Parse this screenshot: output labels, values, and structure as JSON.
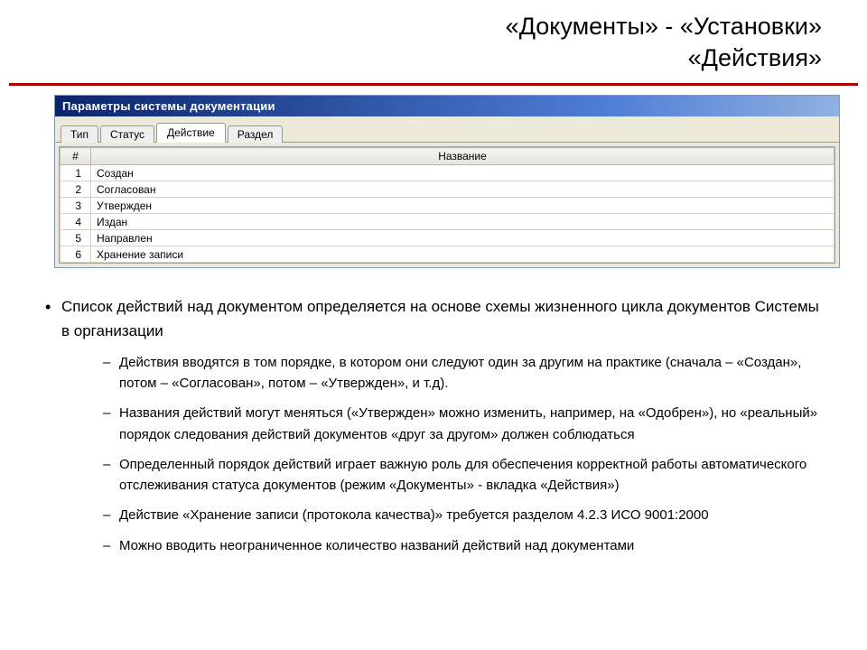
{
  "slide": {
    "title_line1": "«Документы» - «Установки»",
    "title_line2": "«Действия»"
  },
  "window": {
    "title": "Параметры системы документации",
    "tabs": [
      {
        "label": "Тип",
        "active": false
      },
      {
        "label": "Статус",
        "active": false
      },
      {
        "label": "Действие",
        "active": true
      },
      {
        "label": "Раздел",
        "active": false
      }
    ],
    "columns": {
      "num": "#",
      "name": "Название"
    },
    "rows": [
      {
        "n": "1",
        "name": "Создан"
      },
      {
        "n": "2",
        "name": "Согласован"
      },
      {
        "n": "3",
        "name": "Утвержден"
      },
      {
        "n": "4",
        "name": "Издан"
      },
      {
        "n": "5",
        "name": "Направлен"
      },
      {
        "n": "6",
        "name": "Хранение записи"
      }
    ]
  },
  "bullets": {
    "b1": "Список действий над документом определяется на основе схемы жизненного цикла документов Системы в организации",
    "s1": "Действия вводятся в том порядке, в котором они следуют один за другим на практике (сначала – «Создан», потом – «Согласован», потом – «Утвержден», и т.д).",
    "s2": "Названия действий могут меняться («Утвержден» можно изменить, например, на «Одобрен»), но «реальный» порядок следования действий документов «друг за другом» должен соблюдаться",
    "s3": "Определенный порядок действий играет важную роль для обеспечения корректной работы автоматического отслеживания статуса документов (режим «Документы» - вкладка «Действия»)",
    "s4": "Действие «Хранение записи (протокола качества)» требуется разделом 4.2.3 ИСО 9001:2000",
    "s5": "Можно вводить неограниченное количество названий действий над документами"
  }
}
